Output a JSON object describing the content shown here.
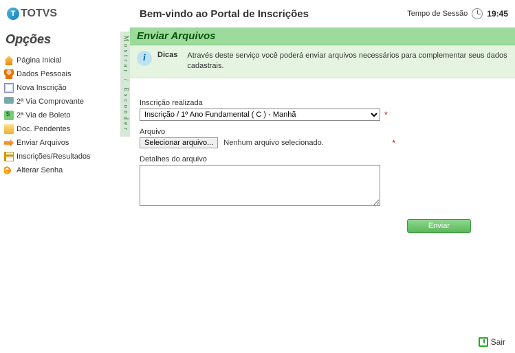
{
  "header": {
    "logo_text": "TOTVS",
    "logo_letter": "T",
    "title": "Bem-vindo ao Portal de Inscrições",
    "session_label": "Tempo de Sessão",
    "session_time": "19:45"
  },
  "sidebar": {
    "title": "Opções",
    "toggle_label": "Mostrar / Esconder",
    "items": [
      {
        "label": "Página Inicial"
      },
      {
        "label": "Dados Pessoais"
      },
      {
        "label": "Nova Inscrição"
      },
      {
        "label": "2ª Via Comprovante"
      },
      {
        "label": "2ª Via de Boleto"
      },
      {
        "label": "Doc. Pendentes"
      },
      {
        "label": "Enviar Arquivos"
      },
      {
        "label": "Inscrições/Resultados"
      },
      {
        "label": "Alterar Senha"
      }
    ]
  },
  "panel": {
    "title": "Enviar Arquivos",
    "tip_label": "Dicas",
    "tip_text": "Através deste serviço você poderá enviar arquivos necessários para complementar seus dados cadastrais."
  },
  "form": {
    "inscricao_label": "Inscrição realizada",
    "inscricao_value": "Inscrição / 1º Ano Fundamental ( C ) - Manhã",
    "arquivo_label": "Arquivo",
    "file_button": "Selecionar arquivo...",
    "file_status": "Nenhum arquivo selecionado.",
    "detalhes_label": "Detalhes do arquivo",
    "detalhes_value": "",
    "required_marker": "*",
    "submit_label": "Enviar"
  },
  "footer": {
    "exit_label": "Sair"
  }
}
